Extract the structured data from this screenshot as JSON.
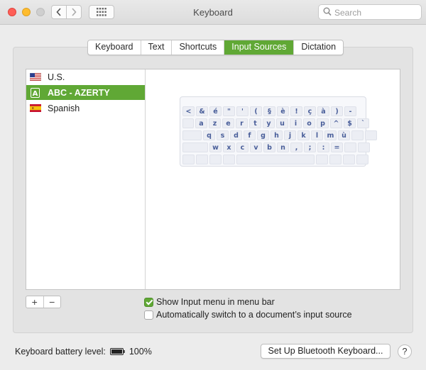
{
  "window": {
    "title": "Keyboard"
  },
  "search": {
    "placeholder": "Search",
    "value": ""
  },
  "tabs": [
    "Keyboard",
    "Text",
    "Shortcuts",
    "Input Sources",
    "Dictation"
  ],
  "active_tab": "Input Sources",
  "sources": [
    {
      "label": "U.S.",
      "icon": "us-flag-icon",
      "selected": false
    },
    {
      "label": "ABC - AZERTY",
      "icon": "abc-letter-icon",
      "selected": true
    },
    {
      "label": "Spanish",
      "icon": "spain-flag-icon",
      "selected": false
    }
  ],
  "keyboard_rows": [
    [
      "<",
      "&",
      "é",
      "\"",
      "'",
      "(",
      "§",
      "è",
      "!",
      "ç",
      "à",
      ")",
      "-"
    ],
    [
      "a",
      "z",
      "e",
      "r",
      "t",
      "y",
      "u",
      "i",
      "o",
      "p",
      "^",
      "$",
      "`"
    ],
    [
      "q",
      "s",
      "d",
      "f",
      "g",
      "h",
      "j",
      "k",
      "l",
      "m",
      "ù"
    ],
    [
      "w",
      "x",
      "c",
      "v",
      "b",
      "n",
      ",",
      ";",
      ":",
      "="
    ]
  ],
  "buttons": {
    "add": "+",
    "remove": "−",
    "bluetooth": "Set Up Bluetooth Keyboard...",
    "help": "?"
  },
  "options": {
    "show_input_menu": {
      "label": "Show Input menu in menu bar",
      "checked": true
    },
    "auto_switch": {
      "label": "Automatically switch to a document’s input source",
      "checked": false
    }
  },
  "battery": {
    "label": "Keyboard battery level:",
    "value": "100%"
  },
  "colors": {
    "accent": "#60a835",
    "key_text": "#4a5f9a"
  }
}
